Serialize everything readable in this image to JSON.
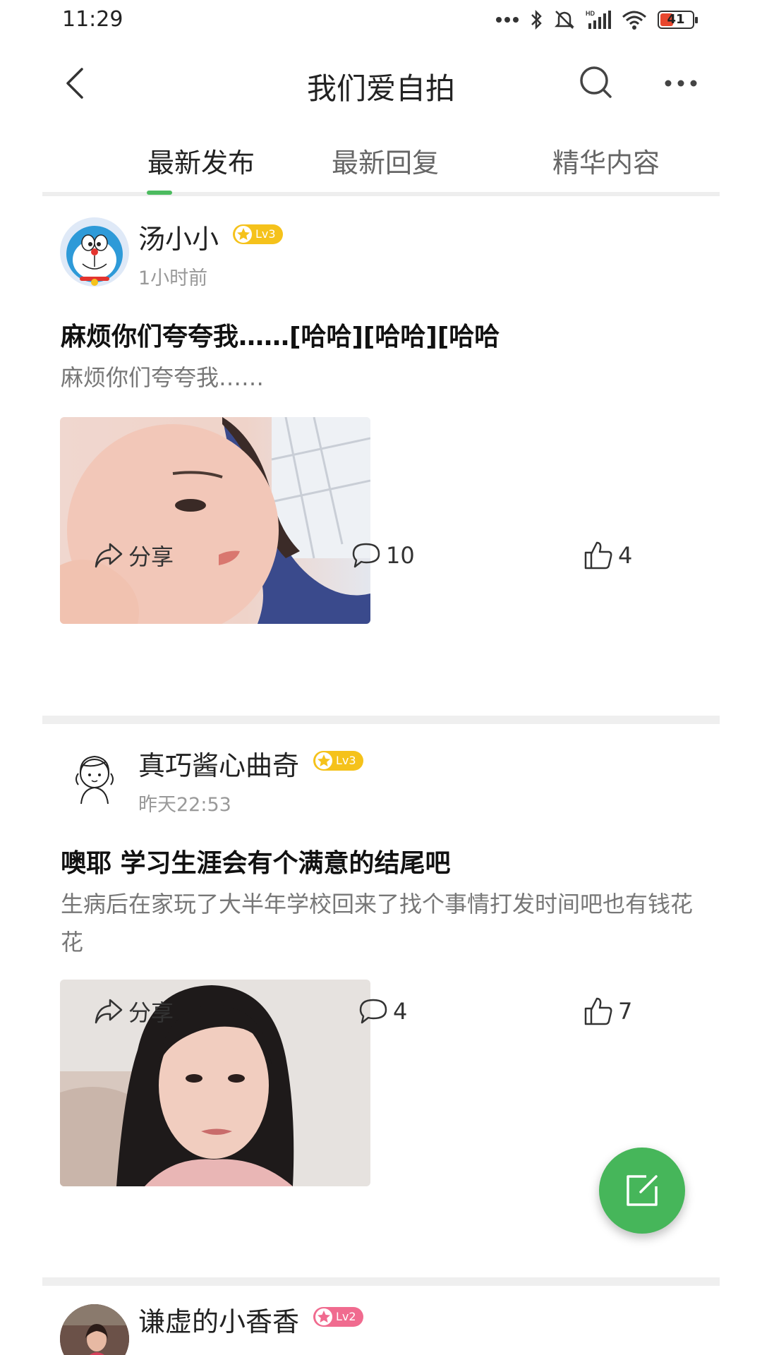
{
  "status_bar": {
    "time": "11:29",
    "battery_level": "41",
    "battery_percent": 41
  },
  "header": {
    "title": "我们爱自拍"
  },
  "tabs": [
    {
      "label": "最新发布",
      "active": true
    },
    {
      "label": "最新回复",
      "active": false
    },
    {
      "label": "精华内容",
      "active": false
    }
  ],
  "posts": [
    {
      "author": "汤小小",
      "level": "Lv3",
      "level_color": "#f5c21b",
      "time": "1小时前",
      "title": "麻烦你们夸夸我……[哈哈][哈哈][哈哈",
      "excerpt": "麻烦你们夸夸我……",
      "share_label": "分享",
      "comments": "10",
      "likes": "4"
    },
    {
      "author": "真巧酱心曲奇",
      "level": "Lv3",
      "level_color": "#f5c21b",
      "time": "昨天22:53",
      "title": "噢耶 学习生涯会有个满意的结尾吧",
      "excerpt": "生病后在家玩了大半年学校回来了找个事情打发时间吧也有钱花花",
      "share_label": "分享",
      "comments": "4",
      "likes": "7"
    },
    {
      "author": "谦虚的小香香",
      "level": "Lv2",
      "level_color": "#f06b8f"
    }
  ],
  "colors": {
    "accent": "#4cbb5f",
    "fab": "#46b65a",
    "separator": "#efefef"
  },
  "icons": {
    "back": "chevron-left-icon",
    "search": "search-icon",
    "more": "more-dots-icon",
    "share": "share-icon",
    "comment": "comment-icon",
    "like": "thumbs-up-icon",
    "compose": "compose-icon"
  }
}
